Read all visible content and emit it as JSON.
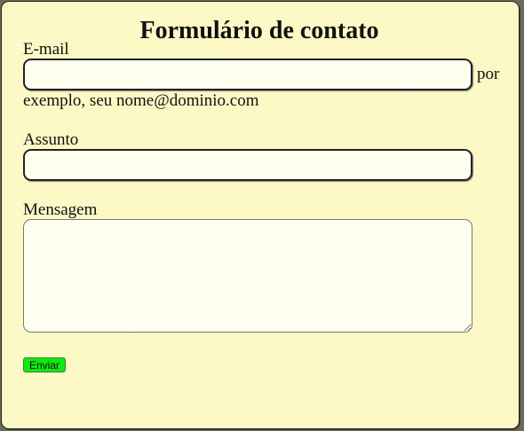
{
  "form": {
    "title": "Formulário de contato",
    "email": {
      "label": "E-mail",
      "value": "",
      "hint_1": "por",
      "hint_2": "exemplo, seu nome@dominio.com"
    },
    "subject": {
      "label": "Assunto",
      "value": ""
    },
    "message": {
      "label": "Mensagem",
      "value": ""
    },
    "submit_label": "Enviar"
  },
  "colors": {
    "background": "#fbf8c2",
    "button": "#11e811"
  }
}
